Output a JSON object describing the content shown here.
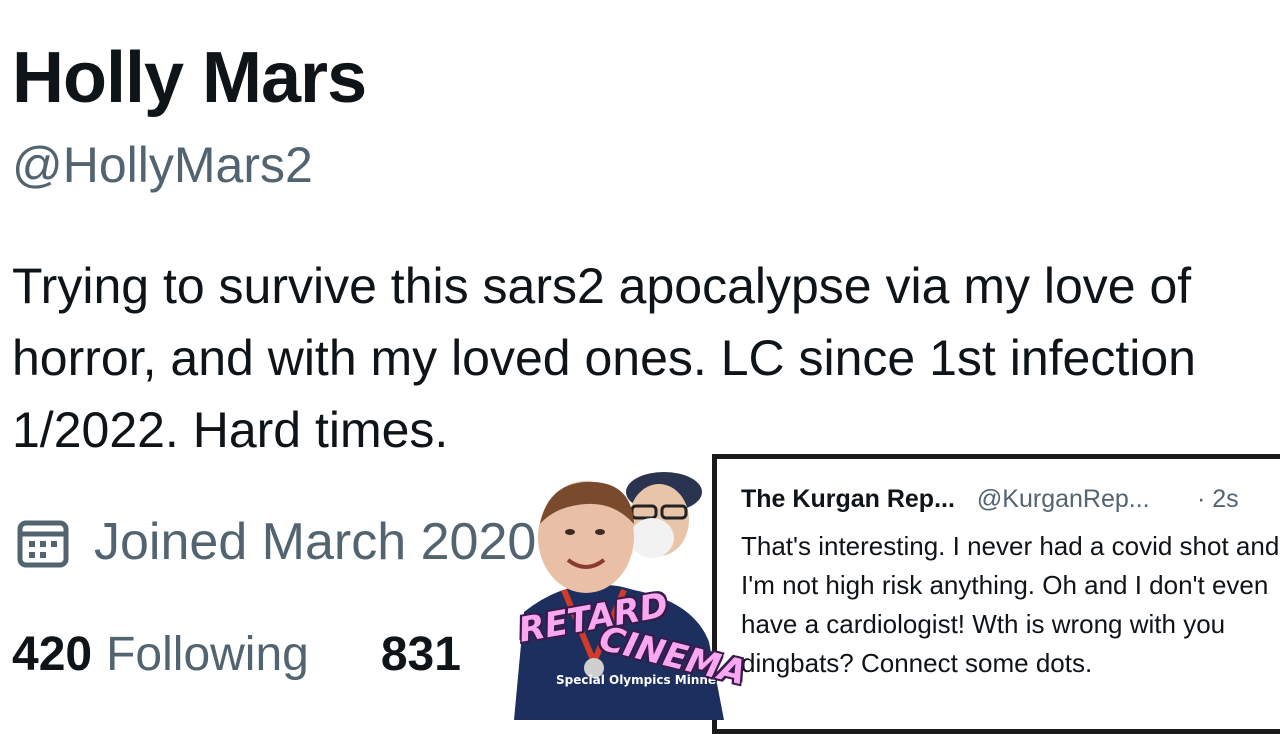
{
  "profile": {
    "name": "Holly Mars",
    "handle": "@HollyMars2",
    "bio": "Trying to survive this sars2 apocalypse via my love of horror, and with my loved ones. LC since 1st infection 1/2022. Hard times.",
    "joined": "Joined March 2020",
    "joined_icon": "calendar-icon",
    "stats": {
      "following_count": "420",
      "following_label": "Following",
      "followers_count": "831"
    }
  },
  "reply_tweet": {
    "author": "The Kurgan Rep...",
    "username": "@KurganRep...",
    "time": "· 2s",
    "text": "That's interesting.  I never had a covid shot and I'm not high risk anything.  Oh and I don't even have a cardiologist!  Wth is wrong with you dingbats? Connect some dots."
  },
  "overlay": {
    "logo_line1": "RETARD",
    "logo_line2": "CINEMA",
    "shirt_text": "Special Olympics Minnesota",
    "logo_color": "#f7a8f0"
  },
  "colors": {
    "text_primary": "#0f1419",
    "text_secondary": "#536471"
  }
}
